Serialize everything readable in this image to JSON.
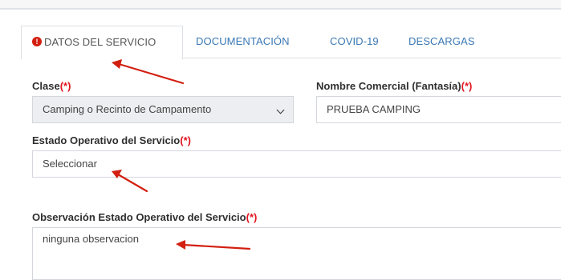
{
  "tabs": [
    {
      "label": "DATOS DEL SERVICIO",
      "active": true,
      "has_error_icon": true
    },
    {
      "label": "DOCUMENTACIÓN",
      "active": false
    },
    {
      "label": "COVID-19",
      "active": false
    },
    {
      "label": "DESCARGAS",
      "active": false
    }
  ],
  "form": {
    "clase": {
      "label": "Clase",
      "required_mark": "(*)",
      "value": "Camping o Recinto de Campamento"
    },
    "nombre_comercial": {
      "label": "Nombre Comercial (Fantasía)",
      "required_mark": "(*)",
      "value": "PRUEBA CAMPING"
    },
    "estado_operativo": {
      "label": "Estado Operativo del Servicio",
      "required_mark": "(*)",
      "value": "Seleccionar"
    },
    "observacion": {
      "label": "Observación Estado Operativo del Servicio",
      "required_mark": "(*)",
      "value": "ninguna observacion"
    }
  },
  "colors": {
    "accent": "#3a78b5",
    "required": "#e0141e",
    "error_icon": "#d21f0f",
    "annotation_arrow": "#d21f0f"
  }
}
